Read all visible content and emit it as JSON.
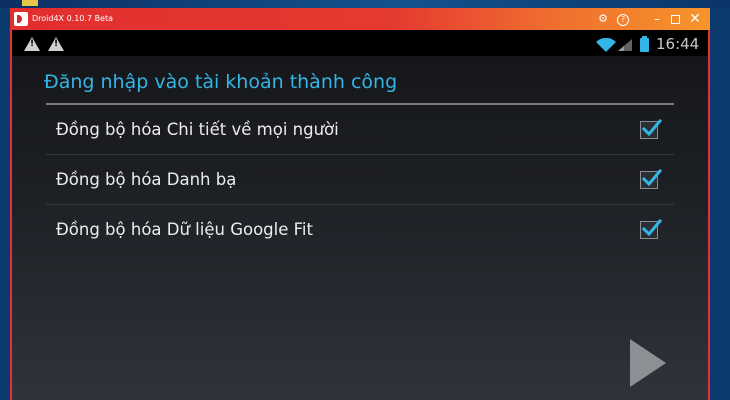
{
  "window": {
    "title": "Droid4X 0.10.7 Beta",
    "icons": [
      "droid4x-logo-icon",
      "gear-icon",
      "help-icon",
      "minimize-icon",
      "maximize-icon",
      "close-icon"
    ],
    "accent_color": "#e53133"
  },
  "status_bar": {
    "icons": [
      "warning-icon",
      "warning-icon",
      "wifi-icon",
      "signal-icon",
      "battery-icon"
    ],
    "time": "16:44"
  },
  "screen": {
    "title": "Đăng nhập vào tài khoản thành công",
    "title_color": "#33b5e5",
    "sync_items": [
      {
        "label": "Đồng bộ hóa Chi tiết về mọi người",
        "checked": true
      },
      {
        "label": "Đồng bộ hóa Danh bạ",
        "checked": true
      },
      {
        "label": "Đồng bộ hóa Dữ liệu Google Fit",
        "checked": true
      }
    ],
    "next_icon": "play-arrow-icon",
    "check_color": "#33b5e5"
  }
}
